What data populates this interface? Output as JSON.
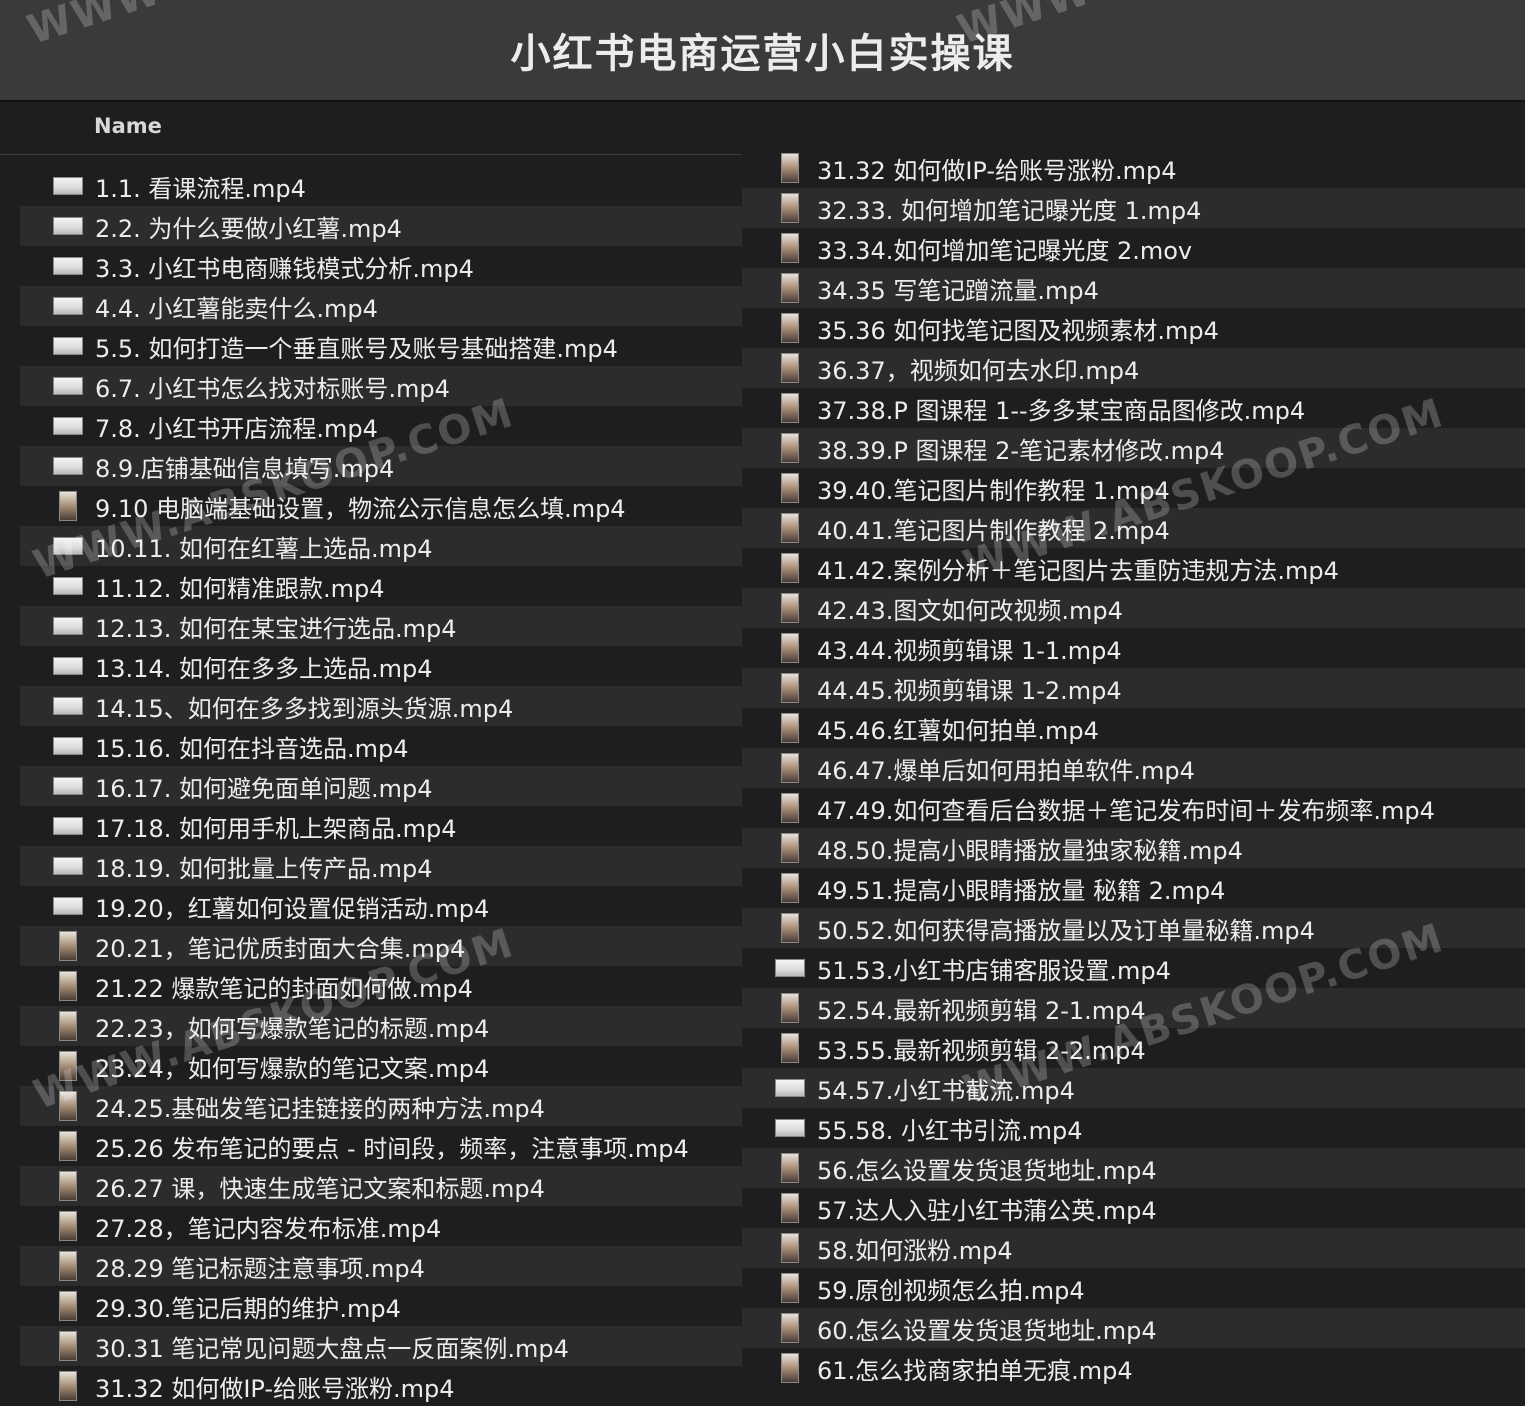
{
  "window": {
    "title": "小红书电商运营小白实操课"
  },
  "header": {
    "name_col": "Name"
  },
  "left_files": [
    {
      "name": "1.1. 看课流程.mp4",
      "thumb": "land"
    },
    {
      "name": "2.2. 为什么要做小红薯.mp4",
      "thumb": "land"
    },
    {
      "name": "3.3. 小红书电商赚钱模式分析.mp4",
      "thumb": "land"
    },
    {
      "name": "4.4. 小红薯能卖什么.mp4",
      "thumb": "land"
    },
    {
      "name": "5.5. 如何打造一个垂直账号及账号基础搭建.mp4",
      "thumb": "land"
    },
    {
      "name": "6.7. 小红书怎么找对标账号.mp4",
      "thumb": "land"
    },
    {
      "name": "7.8. 小红书开店流程.mp4",
      "thumb": "land"
    },
    {
      "name": "8.9.店铺基础信息填写.mp4",
      "thumb": "land"
    },
    {
      "name": "9.10 电脑端基础设置，物流公示信息怎么填.mp4",
      "thumb": "port"
    },
    {
      "name": "10.11. 如何在红薯上选品.mp4",
      "thumb": "land"
    },
    {
      "name": "11.12. 如何精准跟款.mp4",
      "thumb": "land"
    },
    {
      "name": "12.13. 如何在某宝进行选品.mp4",
      "thumb": "land"
    },
    {
      "name": "13.14. 如何在多多上选品.mp4",
      "thumb": "land"
    },
    {
      "name": "14.15、如何在多多找到源头货源.mp4",
      "thumb": "land"
    },
    {
      "name": "15.16. 如何在抖音选品.mp4",
      "thumb": "land"
    },
    {
      "name": "16.17. 如何避免面单问题.mp4",
      "thumb": "land"
    },
    {
      "name": "17.18. 如何用手机上架商品.mp4",
      "thumb": "land"
    },
    {
      "name": "18.19. 如何批量上传产品.mp4",
      "thumb": "land"
    },
    {
      "name": "19.20，红薯如何设置促销活动.mp4",
      "thumb": "land"
    },
    {
      "name": "20.21，笔记优质封面大合集.mp4",
      "thumb": "port"
    },
    {
      "name": "21.22 爆款笔记的封面如何做.mp4",
      "thumb": "port"
    },
    {
      "name": "22.23，如何写爆款笔记的标题.mp4",
      "thumb": "port"
    },
    {
      "name": "23.24，如何写爆款的笔记文案.mp4",
      "thumb": "port"
    },
    {
      "name": "24.25.基础发笔记挂链接的两种方法.mp4",
      "thumb": "port"
    },
    {
      "name": "25.26 发布笔记的要点 - 时间段，频率，注意事项.mp4",
      "thumb": "port"
    },
    {
      "name": "26.27 课，快速生成笔记文案和标题.mp4",
      "thumb": "port"
    },
    {
      "name": "27.28，笔记内容发布标准.mp4",
      "thumb": "port"
    },
    {
      "name": "28.29 笔记标题注意事项.mp4",
      "thumb": "port"
    },
    {
      "name": "29.30.笔记后期的维护.mp4",
      "thumb": "port"
    },
    {
      "name": "30.31 笔记常见问题大盘点一反面案例.mp4",
      "thumb": "port"
    },
    {
      "name": "31.32 如何做IP-给账号涨粉.mp4",
      "thumb": "port"
    }
  ],
  "right_files": [
    {
      "name": "31.32 如何做IP-给账号涨粉.mp4",
      "thumb": "port"
    },
    {
      "name": "32.33. 如何增加笔记曝光度 1.mp4",
      "thumb": "port"
    },
    {
      "name": "33.34.如何增加笔记曝光度 2.mov",
      "thumb": "port"
    },
    {
      "name": "34.35 写笔记蹭流量.mp4",
      "thumb": "port"
    },
    {
      "name": "35.36 如何找笔记图及视频素材.mp4",
      "thumb": "port"
    },
    {
      "name": "36.37，视频如何去水印.mp4",
      "thumb": "port"
    },
    {
      "name": "37.38.P 图课程 1--多多某宝商品图修改.mp4",
      "thumb": "port"
    },
    {
      "name": "38.39.P 图课程 2-笔记素材修改.mp4",
      "thumb": "port"
    },
    {
      "name": "39.40.笔记图片制作教程 1.mp4",
      "thumb": "port"
    },
    {
      "name": "40.41.笔记图片制作教程 2.mp4",
      "thumb": "port"
    },
    {
      "name": "41.42.案例分析＋笔记图片去重防违规方法.mp4",
      "thumb": "port"
    },
    {
      "name": "42.43.图文如何改视频.mp4",
      "thumb": "port"
    },
    {
      "name": "43.44.视频剪辑课 1-1.mp4",
      "thumb": "port"
    },
    {
      "name": "44.45.视频剪辑课 1-2.mp4",
      "thumb": "port"
    },
    {
      "name": "45.46.红薯如何拍单.mp4",
      "thumb": "port"
    },
    {
      "name": "46.47.爆单后如何用拍单软件.mp4",
      "thumb": "port"
    },
    {
      "name": "47.49.如何查看后台数据＋笔记发布时间＋发布频率.mp4",
      "thumb": "port"
    },
    {
      "name": "48.50.提高小眼睛播放量独家秘籍.mp4",
      "thumb": "port"
    },
    {
      "name": "49.51.提高小眼睛播放量 秘籍 2.mp4",
      "thumb": "port"
    },
    {
      "name": "50.52.如何获得高播放量以及订单量秘籍.mp4",
      "thumb": "port"
    },
    {
      "name": "51.53.小红书店铺客服设置.mp4",
      "thumb": "land"
    },
    {
      "name": "52.54.最新视频剪辑 2-1.mp4",
      "thumb": "port"
    },
    {
      "name": "53.55.最新视频剪辑 2-2.mp4",
      "thumb": "port"
    },
    {
      "name": "54.57.小红书截流.mp4",
      "thumb": "land"
    },
    {
      "name": "55.58. 小红书引流.mp4",
      "thumb": "land"
    },
    {
      "name": "56.怎么设置发货退货地址.mp4",
      "thumb": "port"
    },
    {
      "name": "57.达人入驻小红书蒲公英.mp4",
      "thumb": "port"
    },
    {
      "name": "58.如何涨粉.mp4",
      "thumb": "port"
    },
    {
      "name": "59.原创视频怎么拍.mp4",
      "thumb": "port"
    },
    {
      "name": "60.怎么设置发货退货地址.mp4",
      "thumb": "port"
    },
    {
      "name": "61.怎么找商家拍单无痕.mp4",
      "thumb": "port"
    }
  ],
  "watermark": {
    "text": "WWW.ABSKOOP.COM",
    "top_text": "WWW"
  }
}
